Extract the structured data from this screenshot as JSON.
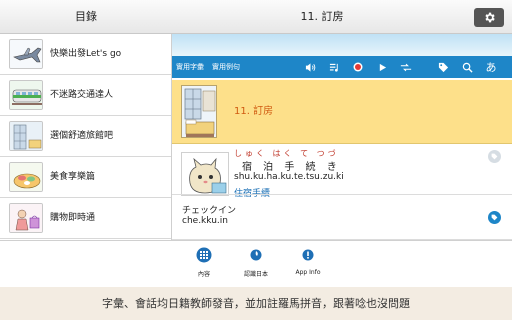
{
  "topbar": {
    "left_title": "目錄",
    "center_title": "11. 訂房"
  },
  "sidebar": {
    "items": [
      {
        "label": "快樂出發Let's go"
      },
      {
        "label": "不迷路交通達人"
      },
      {
        "label": "選個舒適旅館吧"
      },
      {
        "label": "美食享樂篇"
      },
      {
        "label": "購物即時通"
      }
    ]
  },
  "toolbar": {
    "tab_vocab": "實用字彙",
    "tab_sentence": "實用例句",
    "hiragana_label": "あ"
  },
  "lesson": {
    "title": "11. 訂房"
  },
  "entries": [
    {
      "furigana": "しゅく はく て つづ",
      "kanji": "宿 泊 手 続 き",
      "romaji": "shu.ku.ha.ku.te.tsu.zu.ki",
      "translation": "住宿手續"
    },
    {
      "japanese": "チェックイン",
      "romaji": "che.kku.in"
    }
  ],
  "bottomnav": {
    "items": [
      {
        "label": "內容"
      },
      {
        "label": "認識日本"
      },
      {
        "label": "App Info"
      }
    ]
  },
  "caption": "字彙、會話均日籍教師發音，並加註羅馬拼音，跟著唸也沒問題",
  "colors": {
    "toolbar_blue": "#1e86c8",
    "lesson_yellow": "#fde08a",
    "lesson_title_orange": "#d05a10",
    "translation_blue": "#1a6fb5",
    "furigana_red": "#c0392b"
  }
}
